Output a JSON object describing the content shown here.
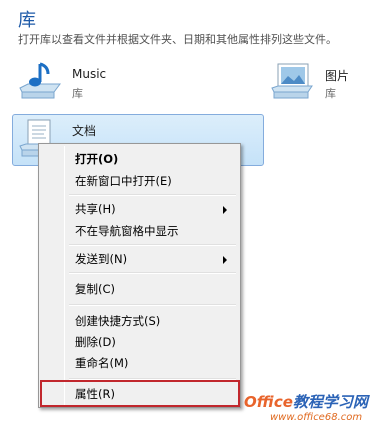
{
  "header": {
    "title": "库",
    "subtitle": "打开库以查看文件并根据文件夹、日期和其他属性排列这些文件。"
  },
  "libraries": [
    {
      "name": "Music",
      "type": "库",
      "icon": "music-library-icon"
    },
    {
      "name": "图片",
      "type": "库",
      "icon": "pictures-library-icon"
    },
    {
      "name": "文档",
      "type": "",
      "icon": "documents-library-icon"
    }
  ],
  "context_menu": {
    "items": [
      {
        "label": "打开(O)",
        "bold": true
      },
      {
        "label": "在新窗口中打开(E)"
      },
      {
        "label": "共享(H)",
        "submenu": true
      },
      {
        "label": "不在导航窗格中显示"
      },
      {
        "label": "发送到(N)",
        "submenu": true
      },
      {
        "label": "复制(C)"
      },
      {
        "label": "创建快捷方式(S)"
      },
      {
        "label": "删除(D)"
      },
      {
        "label": "重命名(M)"
      },
      {
        "label": "属性(R)",
        "highlighted": true
      }
    ]
  },
  "watermark": {
    "brand": "Office",
    "cn": "教程学习网",
    "url": "www.office68.com"
  },
  "colors": {
    "title": "#1e5aa8",
    "selection": "#c5e2f8",
    "highlight_border": "#c1272d"
  }
}
